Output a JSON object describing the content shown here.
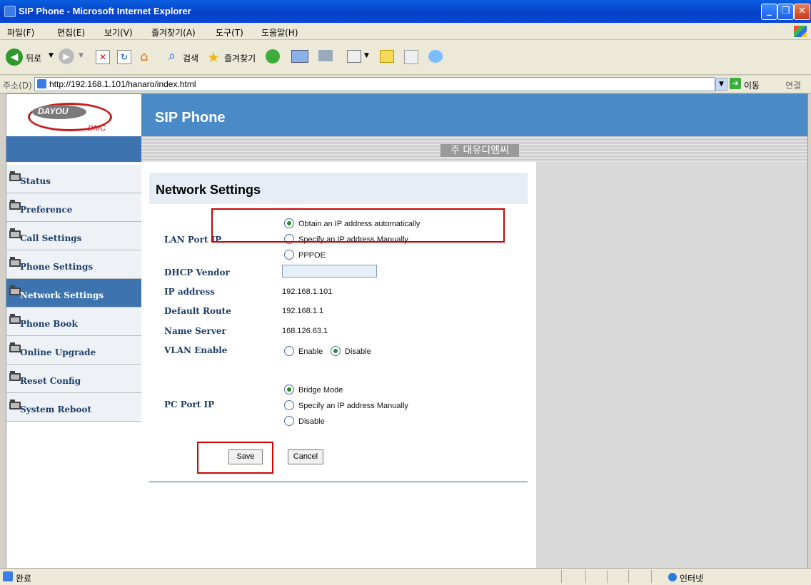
{
  "window": {
    "title": "SIP Phone - Microsoft Internet Explorer"
  },
  "menu": [
    "파일(F)",
    "편집(E)",
    "보기(V)",
    "즐겨찾기(A)",
    "도구(T)",
    "도움말(H)"
  ],
  "toolbar": {
    "back": "뒤로",
    "search": "검색",
    "favorites": "즐겨찾기"
  },
  "address": {
    "label": "주소(D)",
    "url": "http://192.168.1.101/hanaro/index.html",
    "go": "이동",
    "links": "연결"
  },
  "logo": {
    "text": "DAYOU",
    "sub": "DMC"
  },
  "header": {
    "title": "SIP Phone",
    "company": "주 대유디엠씨"
  },
  "sidebar": {
    "items": [
      {
        "label": "Status"
      },
      {
        "label": "Preference"
      },
      {
        "label": "Call Settings"
      },
      {
        "label": "Phone Settings"
      },
      {
        "label": "Network Settings",
        "active": true
      },
      {
        "label": "Phone Book"
      },
      {
        "label": "Online Upgrade"
      },
      {
        "label": "Reset Config"
      },
      {
        "label": "System Reboot"
      }
    ]
  },
  "form": {
    "title": "Network Settings",
    "lan_label": "LAN Port IP",
    "lan_options": [
      "Obtain an IP address automatically",
      "Specify an IP address Manually",
      "PPPOE"
    ],
    "lan_selected": 0,
    "dhcp_label": "DHCP Vendor",
    "dhcp_value": "",
    "ip_label": "IP address",
    "ip_value": "192.168.1.101",
    "route_label": "Default Route",
    "route_value": "192.168.1.1",
    "ns_label": "Name Server",
    "ns_value": "168.126.63.1",
    "vlan_label": "VLAN Enable",
    "vlan_enable": "Enable",
    "vlan_disable": "Disable",
    "vlan_selected": "Disable",
    "pc_label": "PC Port IP",
    "pc_options": [
      "Bridge Mode",
      "Specify an IP address Manually",
      "Disable"
    ],
    "pc_selected": 0,
    "save": "Save",
    "cancel": "Cancel"
  },
  "status": {
    "text": "완료",
    "zone": "인터넷"
  }
}
